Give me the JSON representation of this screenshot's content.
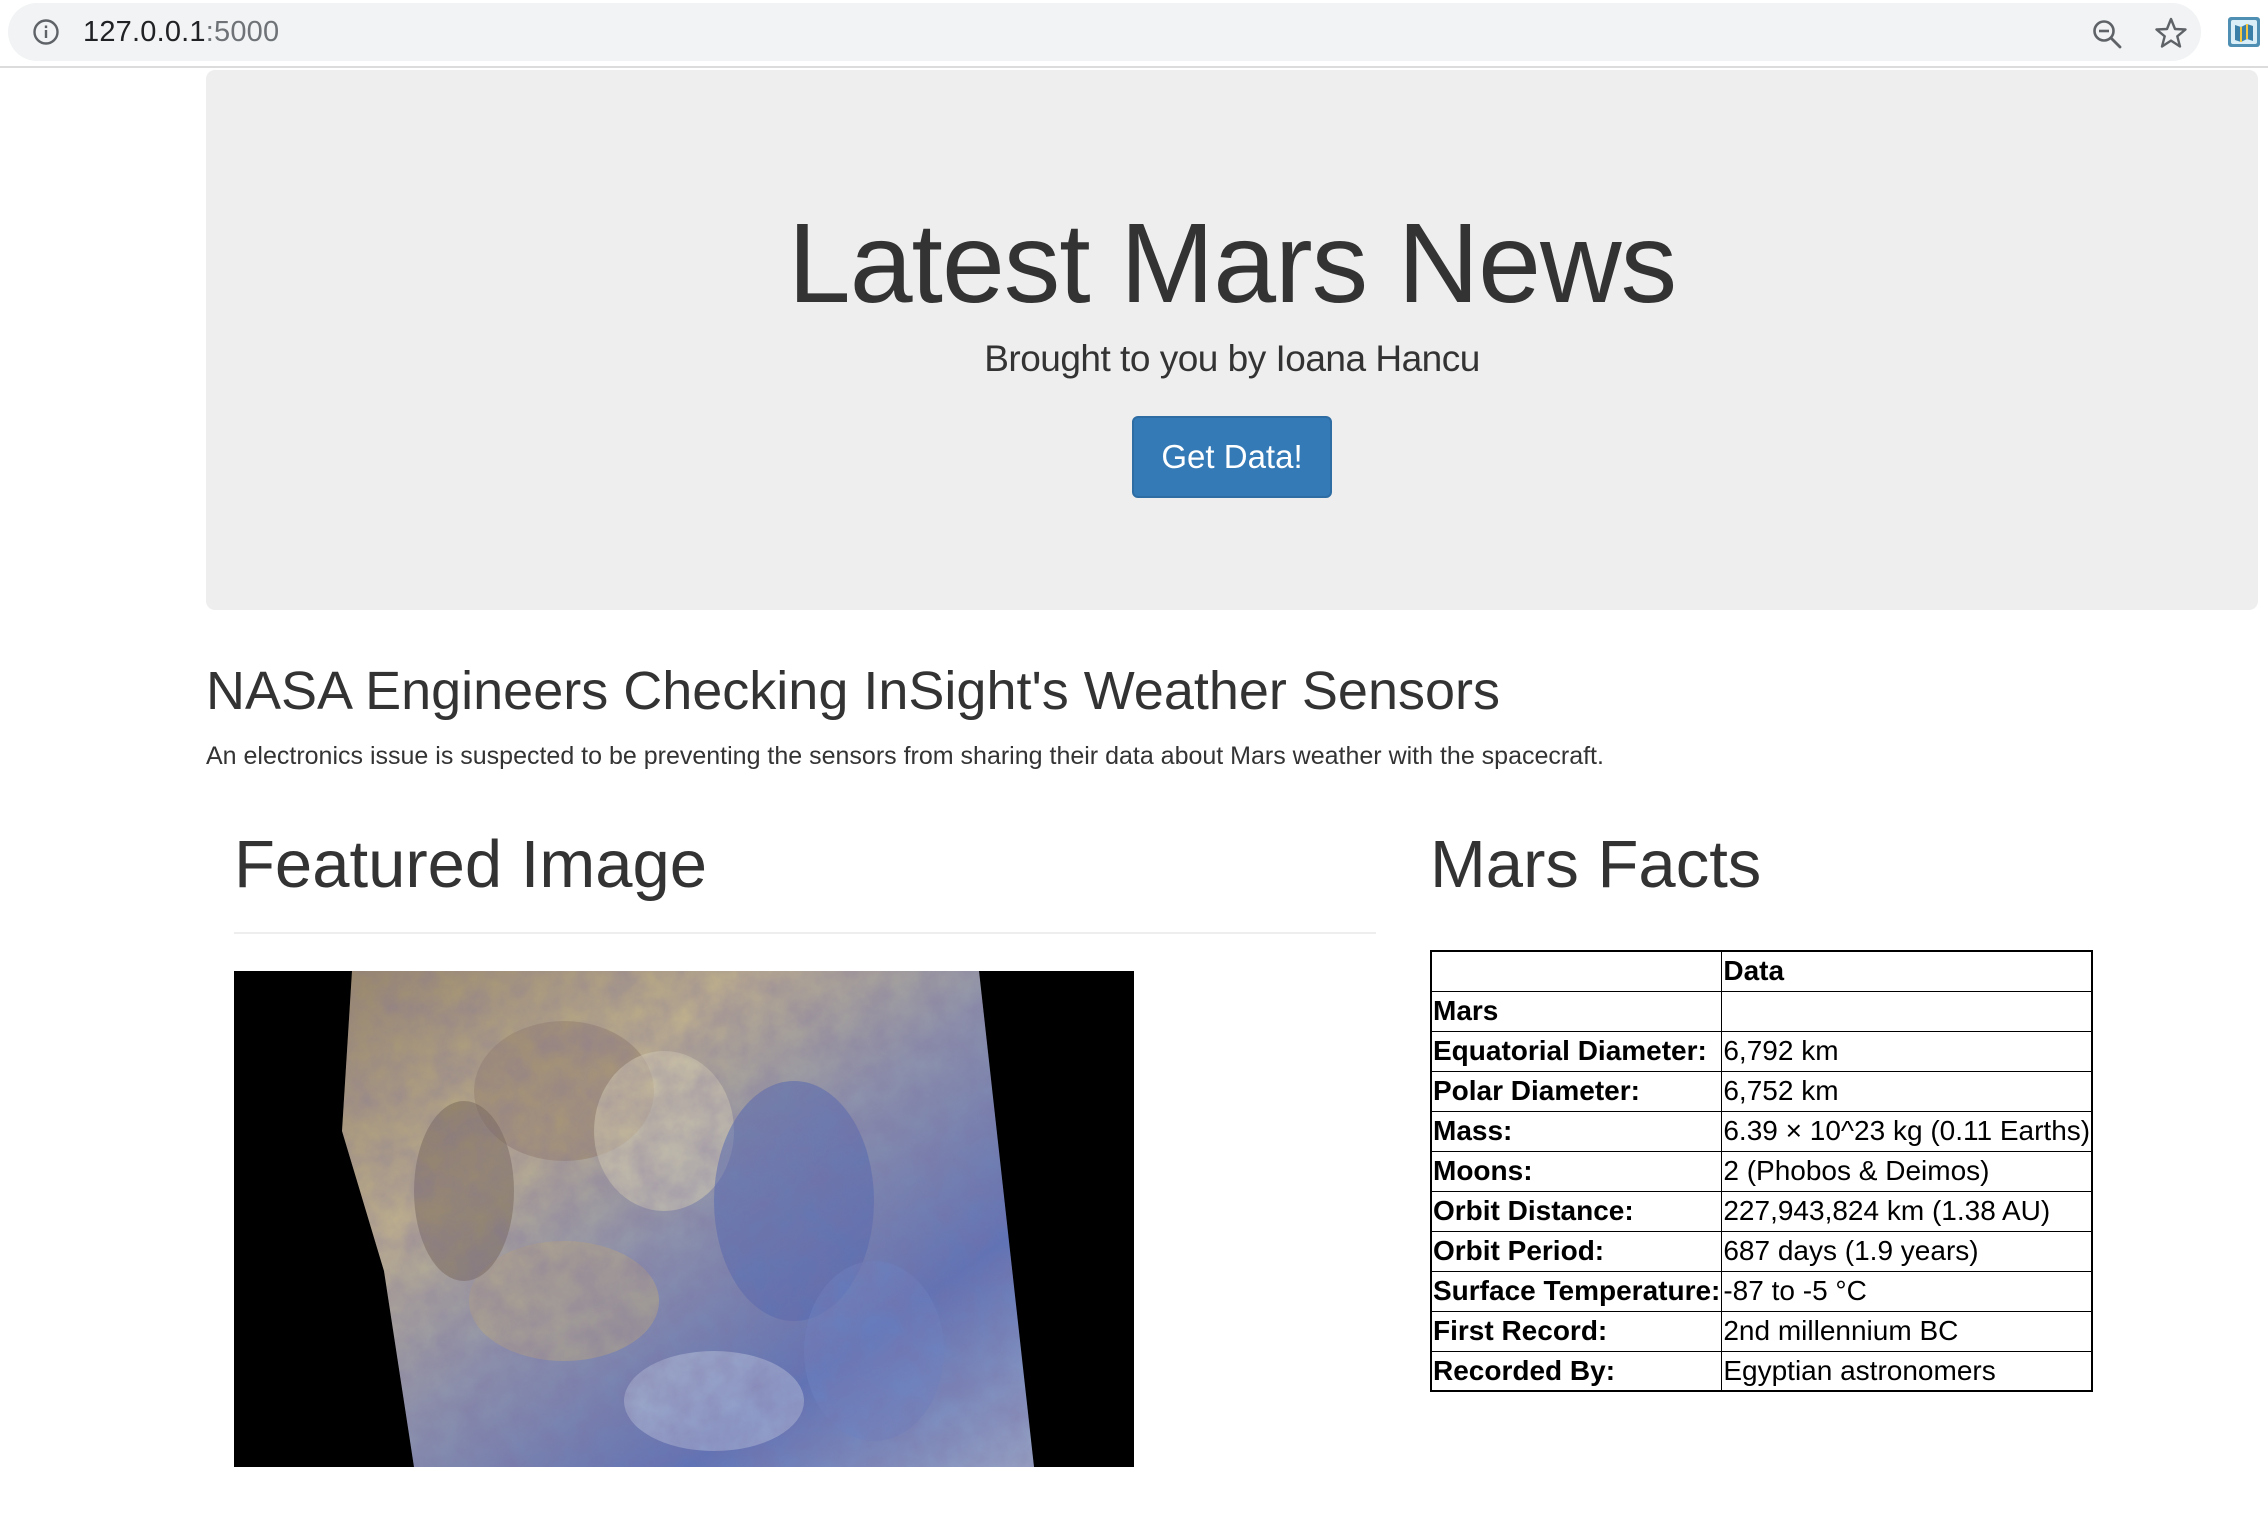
{
  "browser": {
    "url_host": "127.0.0.1",
    "url_port": ":5000",
    "icons": [
      "info-icon",
      "zoom-out-icon",
      "bookmark-star-icon",
      "extension-icon"
    ]
  },
  "jumbotron": {
    "title": "Latest Mars News",
    "subtitle": "Brought to you by Ioana Hancu",
    "button_label": "Get Data!"
  },
  "news": {
    "title": "NASA Engineers Checking InSight's Weather Sensors",
    "paragraph": "An electronics issue is suspected to be preventing the sensors from sharing their data about Mars weather with the spacecraft."
  },
  "featured": {
    "heading": "Featured Image"
  },
  "facts": {
    "heading": "Mars Facts",
    "header": [
      "",
      "Data"
    ],
    "rows": [
      [
        "Mars",
        ""
      ],
      [
        "Equatorial Diameter:",
        "6,792 km"
      ],
      [
        "Polar Diameter:",
        "6,752 km"
      ],
      [
        "Mass:",
        "6.39 × 10^23 kg (0.11 Earths)"
      ],
      [
        "Moons:",
        "2 (Phobos & Deimos)"
      ],
      [
        "Orbit Distance:",
        "227,943,824 km (1.38 AU)"
      ],
      [
        "Orbit Period:",
        "687 days (1.9 years)"
      ],
      [
        "Surface Temperature:",
        "-87 to -5 °C"
      ],
      [
        "First Record:",
        "2nd millennium BC"
      ],
      [
        "Recorded By:",
        "Egyptian astronomers"
      ]
    ]
  },
  "colors": {
    "primary_button": "#337ab7",
    "jumbotron_bg": "#eeeeee",
    "text": "#333333"
  }
}
